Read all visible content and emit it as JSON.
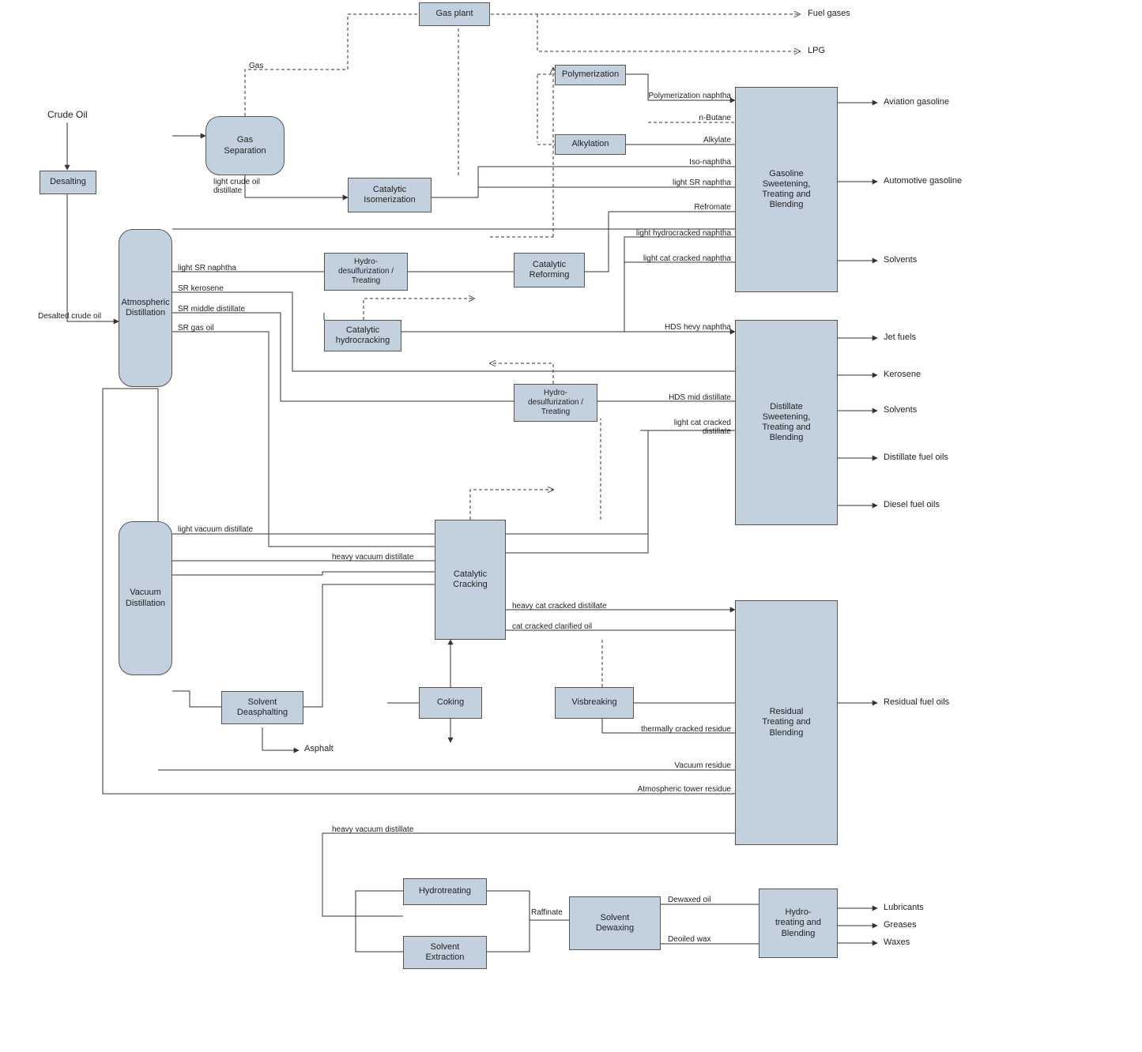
{
  "inputs": {
    "crude_oil": "Crude Oil"
  },
  "units": {
    "desalting": "Desalting",
    "atm_distillation": "Atmospheric\nDistillation",
    "gas_separation": "Gas\nSeparation",
    "gas_plant": "Gas plant",
    "polymerization": "Polymerization",
    "alkylation": "Alkylation",
    "cat_isomerization": "Catalytic\nIsomerization",
    "hydro_desulf_treating_1": "Hydro-\ndesulfurization /\nTreating",
    "cat_reforming": "Catalytic\nReforming",
    "cat_hydrocracking": "Catalytic\nhydrocracking",
    "hydro_desulf_treating_2": "Hydro-\ndesulfurization /\nTreating",
    "vacuum_distillation": "Vacuum\nDistillation",
    "cat_cracking": "Catalytic\nCracking",
    "solvent_deasphalting": "Solvent\nDeasphalting",
    "coking": "Coking",
    "visbreaking": "Visbreaking",
    "hydrotreating": "Hydrotreating",
    "solvent_extraction": "Solvent\nExtraction",
    "solvent_dewaxing": "Solvent\nDewaxing",
    "hydro_treat_blend": "Hydro-\ntreating and\nBlending",
    "gasoline_block": "Gasoline\nSweetening,\nTreating and\nBlending",
    "distillate_block": "Distillate\nSweetening,\nTreating and\nBlending",
    "residual_block": "Residual\nTreating and\nBlending"
  },
  "streams": {
    "gas": "Gas",
    "light_crude_oil_distillate": "light crude oil\ndistillate",
    "desalted_crude_oil": "Desalted crude oil",
    "light_sr_naphtha": "light SR naphtha",
    "sr_kerosene": "SR kerosene",
    "sr_middle_distillate": "SR middle distillate",
    "sr_gas_oil": "SR gas oil",
    "polymerization_naphtha": "Polymerization naphtha",
    "n_butane": "n-Butane",
    "alkylate": "Alkylate",
    "iso_naphtha": "Iso-naphtha",
    "light_sr_naphtha_to_gasoline": "light SR naphtha",
    "reformate": "Refromate",
    "light_hydrocracked_naphtha": "light hydrocracked naphtha",
    "light_cat_cracked_naphtha": "light cat cracked naphtha",
    "hds_heavy_naphtha": "HDS hevy naphtha",
    "hds_mid_distillate": "HDS mid distillate",
    "light_cat_cracked_distillate": "light cat cracked\ndistillate",
    "light_vacuum_distillate": "light vacuum distillate",
    "heavy_vacuum_distillate_1": "heavy vacuum distillate",
    "heavy_cat_cracked_distillate": "heavy cat cracked distillate",
    "cat_cracked_clarified_oil": "cat cracked clarified oil",
    "thermally_cracked_residue": "thermally cracked residue",
    "vacuum_residue": "Vacuum residue",
    "atmospheric_tower_residue": "Atmospheric tower residue",
    "heavy_vacuum_distillate_2": "heavy vacuum distillate",
    "asphalt": "Asphalt",
    "raffinate": "Raffinate",
    "dewaxed_oil": "Dewaxed oil",
    "deoiled_wax": "Deoiled wax"
  },
  "outputs": {
    "fuel_gases": "Fuel gases",
    "lpg": "LPG",
    "aviation_gasoline": "Aviation gasoline",
    "automotive_gasoline": "Automotive gasoline",
    "solvents_gasoline": "Solvents",
    "jet_fuels": "Jet fuels",
    "kerosene": "Kerosene",
    "solvents_distillate": "Solvents",
    "distillate_fuel_oils": "Distillate fuel oils",
    "diesel_fuel_oils": "Diesel fuel oils",
    "residual_fuel_oils": "Residual fuel oils",
    "lubricants": "Lubricants",
    "greases": "Greases",
    "waxes": "Waxes"
  }
}
